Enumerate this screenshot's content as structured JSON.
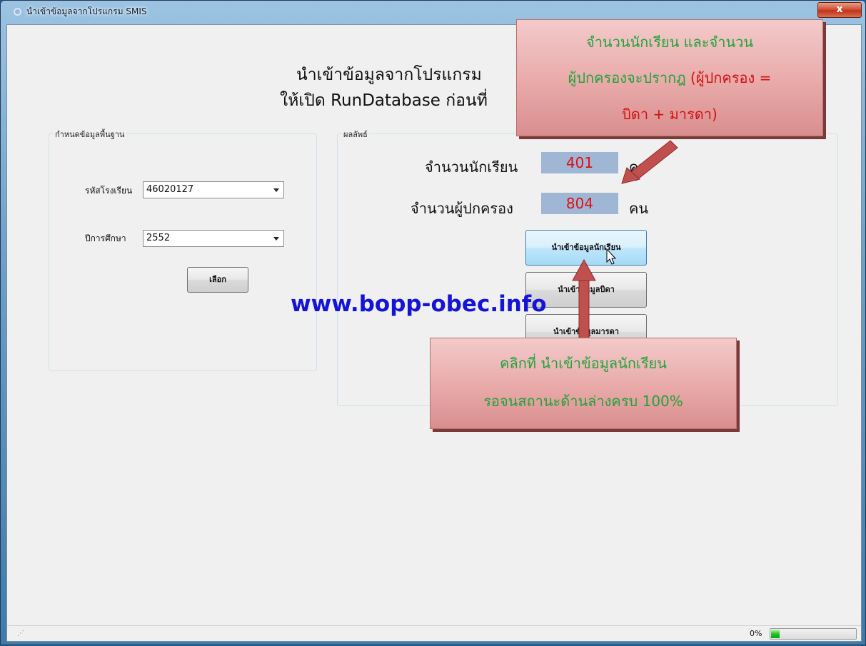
{
  "window": {
    "title": "นำเข้าข้อมูลจากโปรแกรม SMIS",
    "close_symbol": "x"
  },
  "heading": {
    "line1": "นำเข้าข้อมูลจากโปรแกรม",
    "line2": "ให้เปิด RunDatabase ก่อนที่"
  },
  "left_group": {
    "title": "กำหนดข้อมูลพื้นฐาน",
    "school_code_label": "รหัสโรงเรียน",
    "school_code_value": "46020127",
    "year_label": "ปีการศึกษา",
    "year_value": "2552",
    "select_button": "เลือก"
  },
  "right_group": {
    "title": "ผลลัพธ์",
    "students_label": "จำนวนนักเรียน",
    "students_count": "401",
    "students_unit": "คน",
    "parents_label": "จำนวนผู้ปกครอง",
    "parents_count": "804",
    "parents_unit": "คน",
    "import_students_button": "นำเข้าข้อมูลนักเรียน",
    "import_father_button": "นำเข้าข้อมูลบิดา",
    "import_mother_button": "นำเข้าข้อมูลมารดา"
  },
  "watermark": "www.bopp-obec.info",
  "callout_top": {
    "line1": "จำนวนนักเรียน และจำนวน",
    "line2a": "ผู้ปกครองจะปรากฎ",
    "line2b": "(ผู้ปกครอง =",
    "line3": "บิดา + มารดา)"
  },
  "callout_bottom": {
    "line1": "คลิกที่ นำเข้าข้อมูลนักเรียน",
    "line2": "รอจนสถานะด้านล่างครบ 100%"
  },
  "status": {
    "percent_text": "0%",
    "progress_fraction": 0.1
  },
  "colors": {
    "callout_text": "#1fa43a",
    "count_text": "#e01010",
    "watermark": "#1414d6",
    "arrow": "#c0504d"
  }
}
